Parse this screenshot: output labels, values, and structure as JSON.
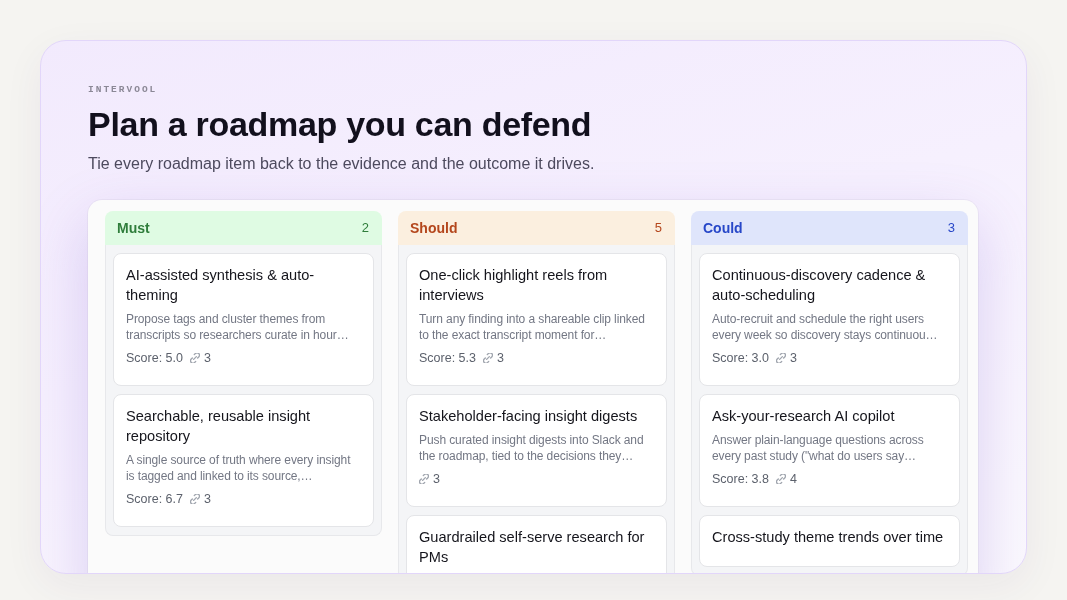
{
  "brand": "INTERVOOL",
  "title": "Plan a roadmap you can defend",
  "subtitle": "Tie every roadmap item back to the evidence and the outcome it drives.",
  "board": {
    "columns": [
      {
        "name": "Must",
        "count": "2",
        "color": "#2f7d3b",
        "cards": [
          {
            "title": "AI-assisted synthesis & auto-theming",
            "description": "Propose tags and cluster themes from transcripts so researchers curate in hour…",
            "score": "Score: 5.0",
            "links": "3"
          },
          {
            "title": "Searchable, reusable insight repository",
            "description": "A single source of truth where every insight is tagged and linked to its source,…",
            "score": "Score: 6.7",
            "links": "3"
          }
        ]
      },
      {
        "name": "Should",
        "count": "5",
        "color": "#b4461c",
        "cards": [
          {
            "title": "One-click highlight reels from interviews",
            "description": "Turn any finding into a shareable clip linked to the exact transcript moment for…",
            "score": "Score: 5.3",
            "links": "3"
          },
          {
            "title": "Stakeholder-facing insight digests",
            "description": "Push curated insight digests into Slack and the roadmap, tied to the decisions they…",
            "links": "3"
          },
          {
            "title": "Guardrailed self-serve research for PMs"
          }
        ]
      },
      {
        "name": "Could",
        "count": "3",
        "color": "#2747c8",
        "cards": [
          {
            "title": "Continuous-discovery cadence & auto-scheduling",
            "description": "Auto-recruit and schedule the right users every week so discovery stays continuou…",
            "score": "Score: 3.0",
            "links": "3"
          },
          {
            "title": "Ask-your-research AI copilot",
            "description": "Answer plain-language questions across every past study (\"what do users say…",
            "score": "Score: 3.8",
            "links": "4"
          },
          {
            "title": "Cross-study theme trends over time"
          }
        ]
      }
    ]
  }
}
